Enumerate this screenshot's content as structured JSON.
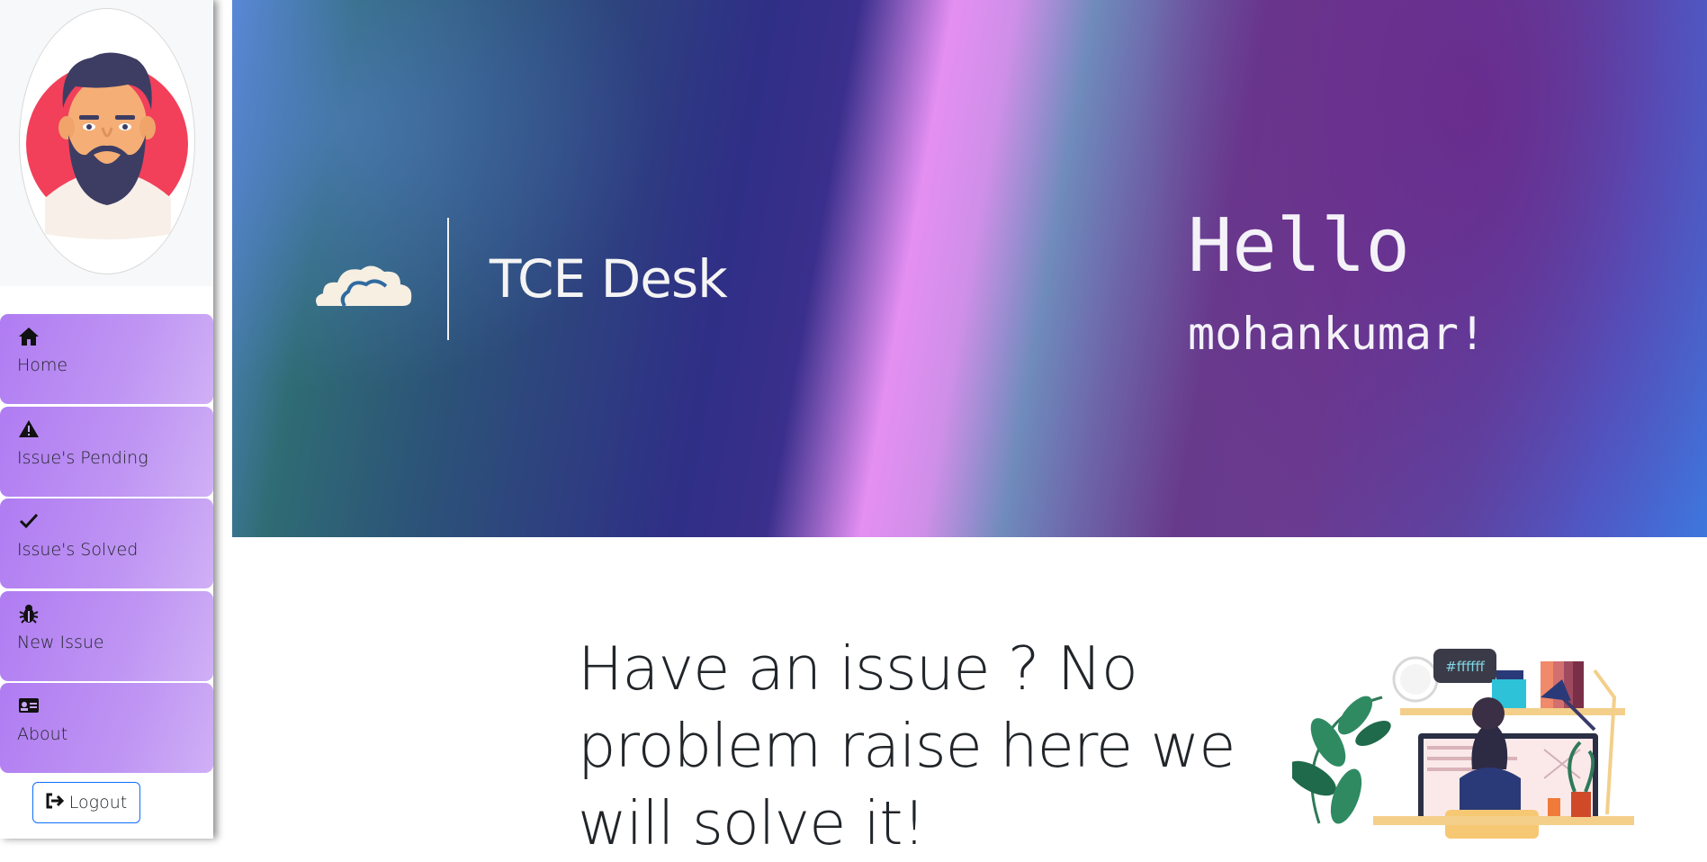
{
  "sidebar": {
    "avatar_alt": "user avatar",
    "items": [
      {
        "label": "Home",
        "icon": "home-icon"
      },
      {
        "label": "Issue's Pending",
        "icon": "warning-icon"
      },
      {
        "label": "Issue's Solved",
        "icon": "check-icon"
      },
      {
        "label": "New Issue",
        "icon": "bug-icon"
      },
      {
        "label": "About",
        "icon": "id-card-icon"
      }
    ],
    "logout_label": "Logout"
  },
  "banner": {
    "brand": "TCE Desk",
    "greeting": "Hello",
    "username": "mohankumar!"
  },
  "main": {
    "tagline": "Have an issue ? No problem raise here we will solve it!",
    "illustration_tag": "#ffffff"
  },
  "colors": {
    "nav_gradient_start": "#b07cf2",
    "nav_gradient_end": "#d0b0f6",
    "logout_border": "#0d6efd",
    "avatar_circle": "#f2405a"
  }
}
